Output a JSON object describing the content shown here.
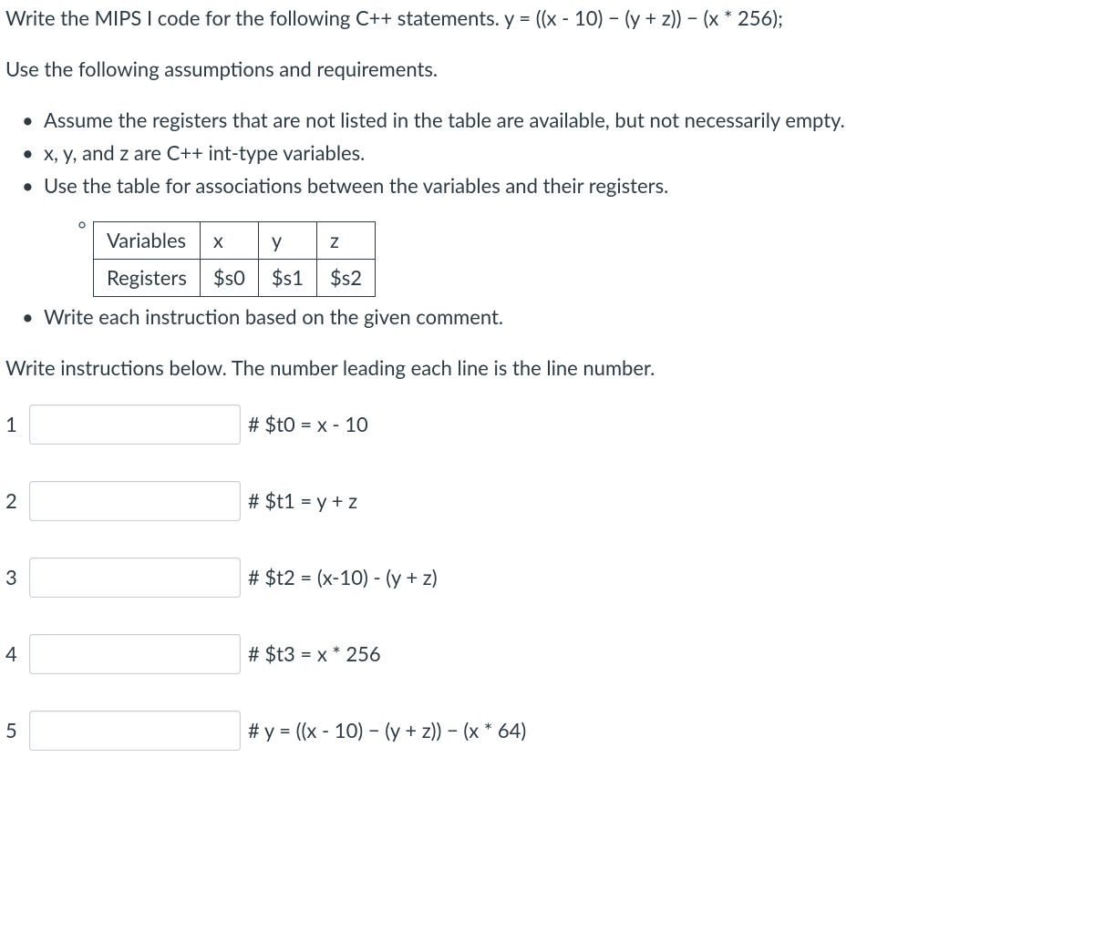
{
  "intro1": "Write the MIPS I code for the following C++ statements. y = ((x - 10) − (y + z)) − (x * 256);",
  "intro2": "Use the following assumptions and requirements.",
  "bullets": {
    "b1": "Assume the registers that are not listed in the table are available, but not necessarily empty.",
    "b2": "x, y, and z are C++ int-type variables.",
    "b3": "Use the table for associations between the variables and their registers.",
    "b4": "Write each instruction based on the given comment."
  },
  "table": {
    "row1": {
      "h": "Variables",
      "c1": "x",
      "c2": "y",
      "c3": "z"
    },
    "row2": {
      "h": "Registers",
      "c1": "$s0",
      "c2": "$s1",
      "c3": "$s2"
    }
  },
  "instructions_prompt": "Write instructions below. The number leading each line is the line number.",
  "lines": {
    "l1": {
      "num": "1",
      "value": "",
      "comment": "# $t0 = x - 10"
    },
    "l2": {
      "num": "2",
      "value": "",
      "comment": "# $t1 = y + z"
    },
    "l3": {
      "num": "3",
      "value": "",
      "comment": "# $t2 = (x-10) - (y + z)"
    },
    "l4": {
      "num": "4",
      "value": "",
      "comment": "# $t3 = x * 256"
    },
    "l5": {
      "num": "5",
      "value": "",
      "comment": "# y = ((x - 10) − (y + z)) − (x * 64)"
    }
  }
}
